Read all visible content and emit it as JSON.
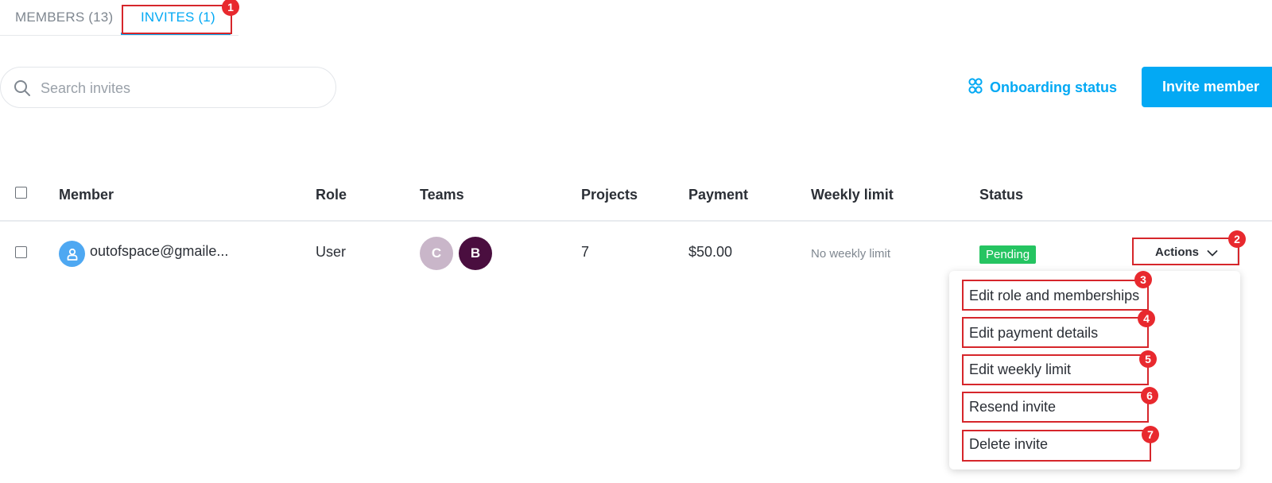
{
  "tabs": {
    "members_label": "MEMBERS (13)",
    "invites_label": "INVITES (1)"
  },
  "search": {
    "placeholder": "Search invites",
    "value": ""
  },
  "toolbar": {
    "onboarding_label": "Onboarding status",
    "invite_label": "Invite member"
  },
  "table": {
    "headers": {
      "member": "Member",
      "role": "Role",
      "teams": "Teams",
      "projects": "Projects",
      "payment": "Payment",
      "weekly_limit": "Weekly limit",
      "status": "Status"
    },
    "rows": [
      {
        "member": "outofspace@gmaile...",
        "role": "User",
        "teams": [
          "C",
          "B"
        ],
        "projects": "7",
        "payment": "$50.00",
        "weekly_limit": "No weekly limit",
        "status": "Pending",
        "actions_label": "Actions"
      }
    ]
  },
  "actions_menu": {
    "items": [
      "Edit role and memberships",
      "Edit payment details",
      "Edit weekly limit",
      "Resend invite",
      "Delete invite"
    ]
  },
  "annotations": [
    "1",
    "2",
    "3",
    "4",
    "5",
    "6",
    "7"
  ],
  "colors": {
    "accent": "#03a9f4",
    "status_pending": "#25c461",
    "annotation_red": "#e8292e",
    "team_c": "#c9b6c9",
    "team_b": "#4a0e3f"
  }
}
